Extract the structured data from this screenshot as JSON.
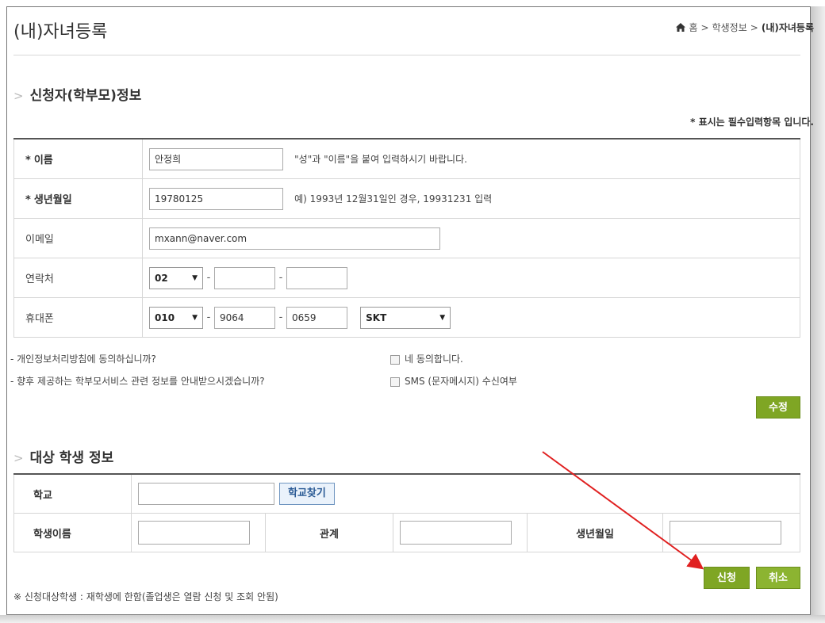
{
  "page_title": "(내)자녀등록",
  "breadcrumb": {
    "home": "홈",
    "sep1": ">",
    "item1": "학생정보",
    "sep2": ">",
    "current": "(내)자녀등록"
  },
  "section_parent": {
    "title": "신청자(학부모)정보"
  },
  "required_note": "* 표시는 필수입력항목 입니다.",
  "parent_form": {
    "name": {
      "star": "*",
      "label": "이름",
      "value": "안정희",
      "hint": "\"성\"과 \"이름\"을 붙여 입력하시기 바랍니다."
    },
    "birth": {
      "star": "*",
      "label": "생년월일",
      "value": "19780125",
      "hint": "예) 1993년 12월31일인 경우, 19931231 입력"
    },
    "email": {
      "label": "이메일",
      "value": "mxann@naver.com"
    },
    "phone": {
      "label": "연락처",
      "area": "02",
      "sep": "-",
      "mid": "",
      "last": ""
    },
    "mobile": {
      "label": "휴대폰",
      "prefix": "010",
      "sep": "-",
      "mid": "9064",
      "last": "0659",
      "carrier": "SKT"
    }
  },
  "consent": {
    "privacy_question": "- 개인정보처리방침에 동의하십니까?",
    "privacy_option": "네 동의합니다.",
    "sms_question": "- 향후 제공하는 학부모서비스 관련 정보를 안내받으시겠습니까?",
    "sms_option": "SMS (문자메시지) 수신여부"
  },
  "modify_button": "수정",
  "section_student": {
    "title": "대상 학생 정보"
  },
  "student_form": {
    "school_label": "학교",
    "school_value": "",
    "school_search_button": "학교찾기",
    "name_label": "학생이름",
    "relation_label": "관계",
    "birth_label": "생년월일"
  },
  "apply_button": "신청",
  "cancel_button": "취소",
  "footnote": "※ 신청대상학생 : 재학생에 한함(졸업생은 열람 신청 및 조회 안됨)",
  "colors": {
    "button_green": "#7fa624",
    "annotation_arrow": "#e02020",
    "school_button": "#2a5a95"
  }
}
